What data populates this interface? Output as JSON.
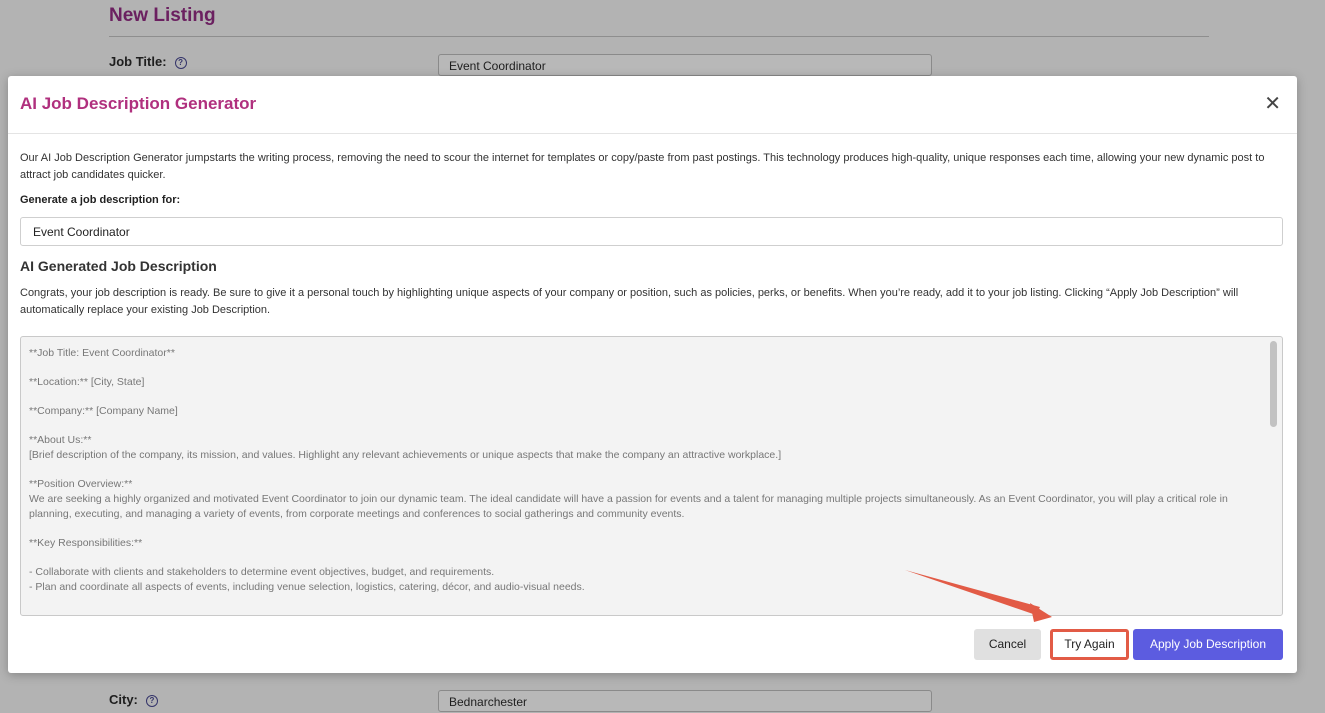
{
  "background": {
    "page_title": "New Listing",
    "job_title_label": "Job Title:",
    "job_title_value": "Event Coordinator",
    "city_label": "City:",
    "city_value": "Bednarchester"
  },
  "modal": {
    "title": "AI Job Description Generator",
    "close_icon": "close-icon",
    "intro": "Our AI Job Description Generator jumpstarts the writing process, removing the need to scour the internet for templates or copy/paste from past postings. This technology produces high-quality, unique responses each time, allowing your new dynamic post to attract job candidates quicker.",
    "generate_label": "Generate a job description for:",
    "generate_value": "Event Coordinator",
    "generated_section_title": "AI Generated Job Description",
    "congrats": "Congrats, your job description is ready. Be sure to give it a personal touch by highlighting unique aspects of your company or position, such as policies, perks, or benefits. When you’re ready, add it to your job listing. Clicking “Apply Job Description” will automatically replace your existing Job Description.",
    "description": {
      "job_title": "**Job Title: Event Coordinator**",
      "location": "**Location:** [City, State]",
      "company": "**Company:** [Company Name]",
      "about_heading": "**About Us:**",
      "about_text": "[Brief description of the company, its mission, and values. Highlight any relevant achievements or unique aspects that make the company an attractive workplace.]",
      "overview_heading": "**Position Overview:**",
      "overview_text": "We are seeking a highly organized and motivated Event Coordinator to join our dynamic team. The ideal candidate will have a passion for events and a talent for managing multiple projects simultaneously. As an Event Coordinator, you will play a critical role in planning, executing, and managing a variety of events, from corporate meetings and conferences to social gatherings and community events.",
      "responsibilities_heading": "**Key Responsibilities:**",
      "responsibility_1": "- Collaborate with clients and stakeholders to determine event objectives, budget, and requirements.",
      "responsibility_2": "- Plan and coordinate all aspects of events, including venue selection, logistics, catering, décor, and audio-visual needs."
    },
    "buttons": {
      "cancel": "Cancel",
      "try_again": "Try Again",
      "apply": "Apply Job Description"
    }
  },
  "colors": {
    "title_accent": "#b0307e",
    "primary_button": "#5c5ce0",
    "highlight_annotation": "#e25b46"
  }
}
